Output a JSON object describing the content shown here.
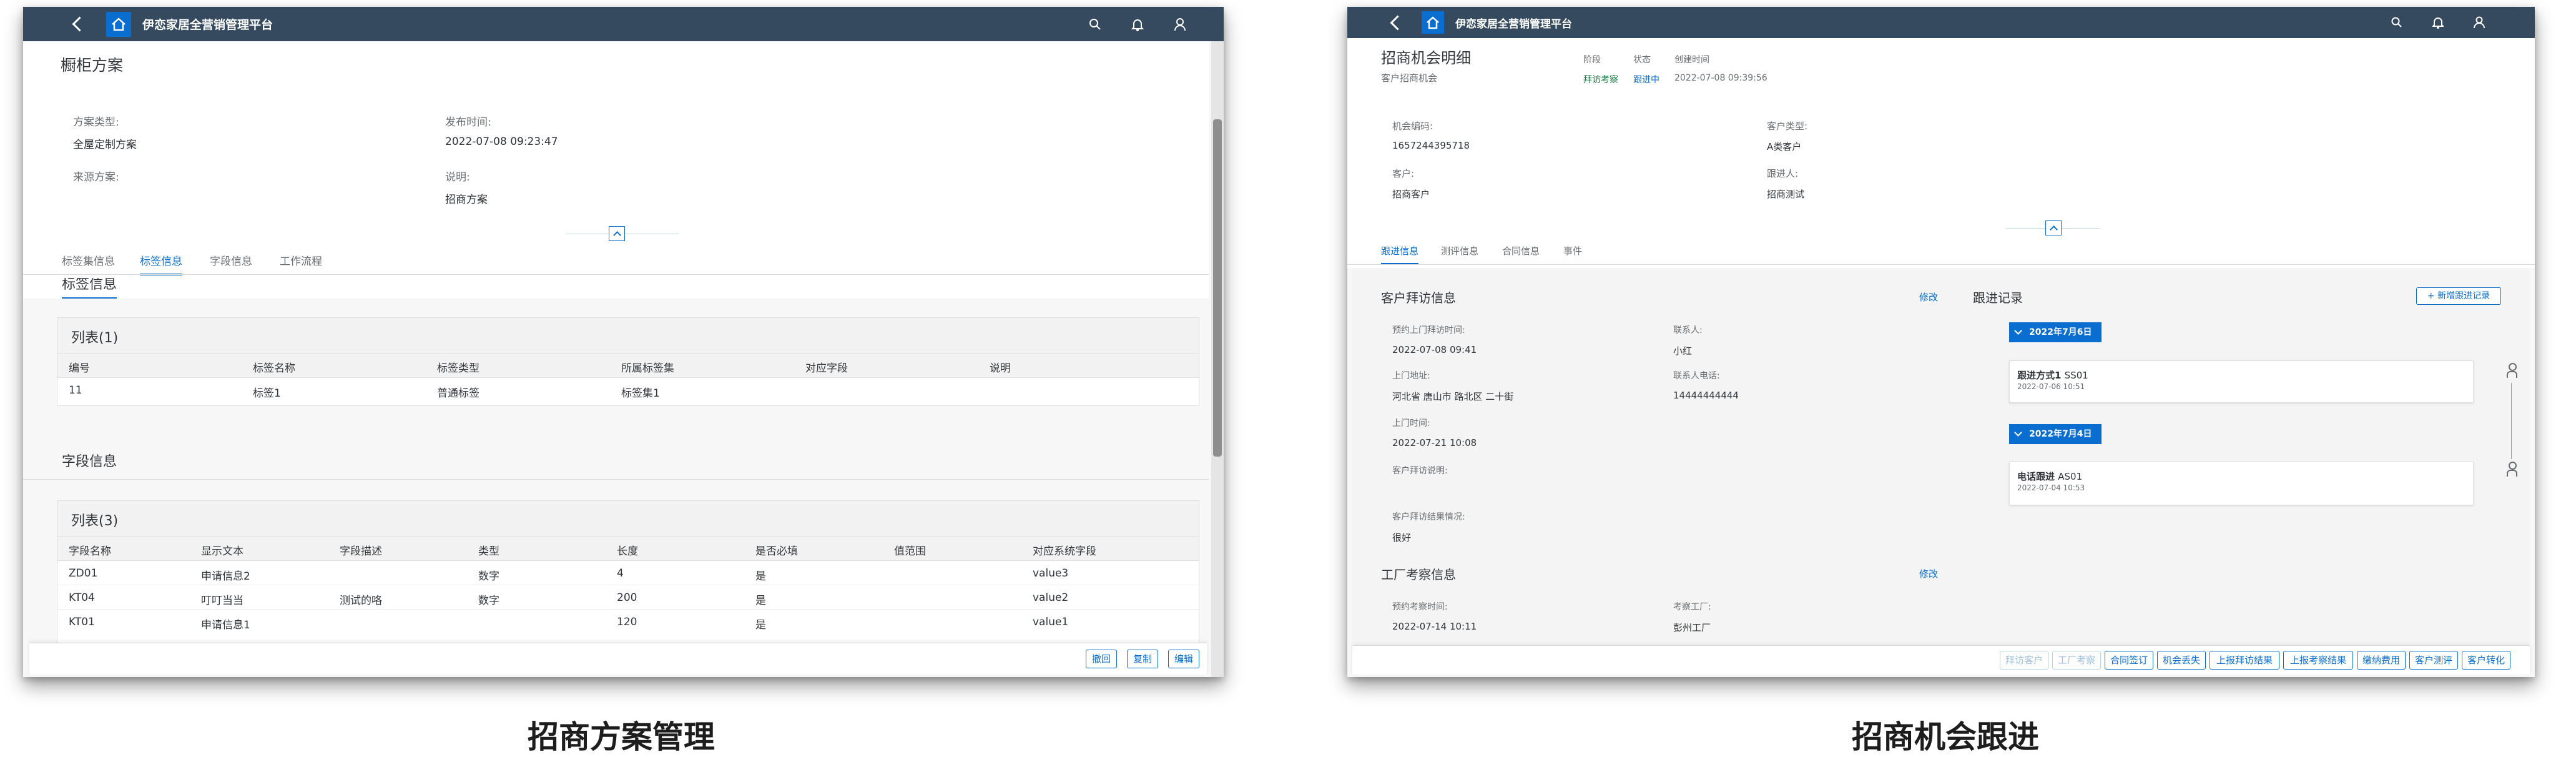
{
  "left": {
    "app_title": "伊恋家居全营销管理平台",
    "page_title": "橱柜方案",
    "fields": [
      {
        "label": "方案类型:",
        "value": "全屋定制方案"
      },
      {
        "label": "发布时间:",
        "value": "2022-07-08 09:23:47"
      },
      {
        "label": "来源方案:",
        "value": ""
      },
      {
        "label": "说明:",
        "value": "招商方案"
      }
    ],
    "tabs": [
      "标签集信息",
      "标签信息",
      "字段信息",
      "工作流程"
    ],
    "active_tab": "标签信息",
    "section_tag_title": "标签信息",
    "tag_table": {
      "title": "列表(1)",
      "columns": [
        "编号",
        "标签名称",
        "标签类型",
        "所属标签集",
        "对应字段",
        "说明"
      ],
      "rows": [
        [
          "11",
          "标签1",
          "普通标签",
          "标签集1",
          "",
          ""
        ]
      ]
    },
    "section_field_title": "字段信息",
    "field_table": {
      "title": "列表(3)",
      "columns": [
        "字段名称",
        "显示文本",
        "字段描述",
        "类型",
        "长度",
        "是否必填",
        "值范围",
        "对应系统字段"
      ],
      "rows": [
        [
          "ZD01",
          "申请信息2",
          "",
          "数字",
          "4",
          "是",
          "",
          "value3"
        ],
        [
          "KT04",
          "叮叮当当",
          "测试的咯",
          "数字",
          "200",
          "是",
          "",
          "value2"
        ],
        [
          "KT01",
          "申请信息1",
          "",
          "",
          "120",
          "是",
          "",
          "value1"
        ]
      ]
    },
    "footer_buttons": [
      "撤回",
      "复制",
      "编辑"
    ],
    "caption": "招商方案管理"
  },
  "right": {
    "app_title": "伊恋家居全营销管理平台",
    "page_title": "招商机会明细",
    "page_subtitle": "客户招商机会",
    "status_headers": [
      "阶段",
      "状态",
      "创建时间"
    ],
    "status_values": [
      "拜访考察",
      "跟进中",
      "2022-07-08 09:39:56"
    ],
    "fields": [
      {
        "label": "机会编码:",
        "value": "1657244395718"
      },
      {
        "label": "客户类型:",
        "value": "A类客户"
      },
      {
        "label": "客户:",
        "value": "招商客户"
      },
      {
        "label": "跟进人:",
        "value": "招商测试"
      }
    ],
    "tabs": [
      "跟进信息",
      "测评信息",
      "合同信息",
      "事件"
    ],
    "active_tab": "跟进信息",
    "visit_section": {
      "title": "客户拜访信息",
      "edit": "修改",
      "fields": [
        {
          "label": "预约上门拜访时间:",
          "value": "2022-07-08 09:41"
        },
        {
          "label": "联系人:",
          "value": "小红"
        },
        {
          "label": "上门地址:",
          "value": "河北省 唐山市 路北区 二十街"
        },
        {
          "label": "联系人电话:",
          "value": "14444444444"
        },
        {
          "label": "上门时间:",
          "value": "2022-07-21 10:08"
        },
        {
          "label": "客户拜访说明:",
          "value": ""
        },
        {
          "label": "客户拜访结果情况:",
          "value": "很好"
        }
      ]
    },
    "factory_section": {
      "title": "工厂考察信息",
      "edit": "修改",
      "fields": [
        {
          "label": "预约考察时间:",
          "value": "2022-07-14 10:11"
        },
        {
          "label": "考察工厂:",
          "value": "彭州工厂"
        }
      ]
    },
    "followup": {
      "title": "跟进记录",
      "add_button": "+ 新增跟进记录",
      "groups": [
        {
          "date": "2022年7月6日",
          "entry_title": "跟进方式1",
          "entry_code": "SS01",
          "entry_time": "2022-07-06 10:51"
        },
        {
          "date": "2022年7月4日",
          "entry_title": "电话跟进",
          "entry_code": "AS01",
          "entry_time": "2022-07-04 10:53"
        }
      ]
    },
    "footer_buttons": [
      {
        "label": "拜访客户",
        "disabled": true
      },
      {
        "label": "工厂考察",
        "disabled": true
      },
      {
        "label": "合同签订",
        "disabled": false
      },
      {
        "label": "机会丢失",
        "disabled": false
      },
      {
        "label": "上报拜访结果",
        "disabled": false
      },
      {
        "label": "上报考察结果",
        "disabled": false
      },
      {
        "label": "缴纳费用",
        "disabled": false
      },
      {
        "label": "客户测评",
        "disabled": false
      },
      {
        "label": "客户转化",
        "disabled": false
      }
    ],
    "caption": "招商机会跟进"
  },
  "colors": {
    "shell_bar": "#354a5f",
    "accent": "#0a6ed1",
    "green_status": "#107e3e"
  }
}
